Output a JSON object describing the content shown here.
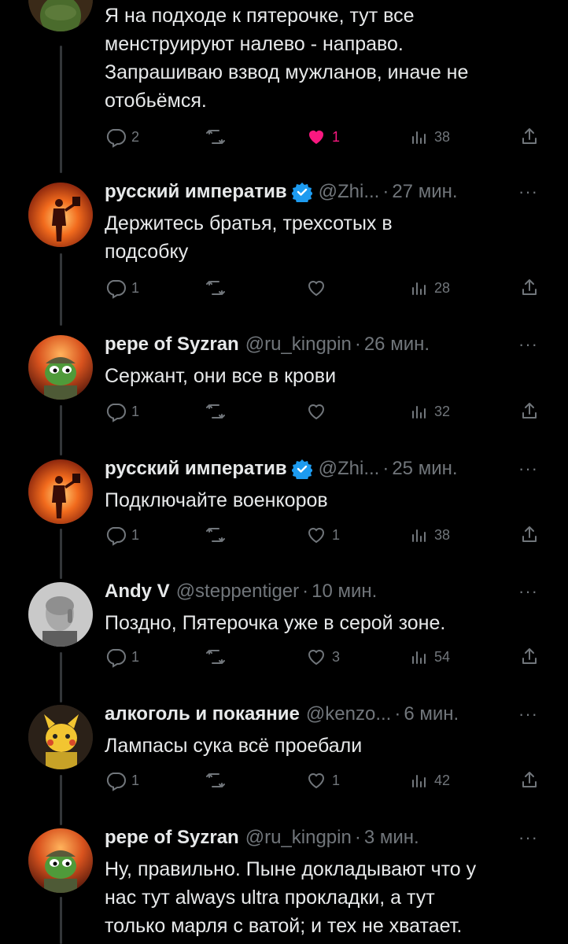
{
  "colors": {
    "background": "#000000",
    "text": "#e7e9ea",
    "muted": "#71767b",
    "like": "#f91880",
    "verified": "#1d9bf0",
    "thread_line": "#333639"
  },
  "icons": {
    "reply": "speech-bubble-icon",
    "retweet": "retweet-icon",
    "like": "heart-icon",
    "views": "bar-chart-icon",
    "share": "share-upload-icon",
    "more": "ellipsis-icon",
    "verified": "verified-badge-icon"
  },
  "more_label": "···",
  "tweets": [
    {
      "name": "",
      "handle": "",
      "time": "",
      "text_lines": [
        "Я на подходе к пятерочке, тут все",
        "менструируют налево - направо.",
        "Запрашиваю взвод мужланов, иначе не",
        "отобьёмся."
      ],
      "replies": "2",
      "retweets": "",
      "likes": "1",
      "liked": true,
      "views": "38"
    },
    {
      "name": "русский императив",
      "verified": true,
      "handle": "@Zhi...",
      "time": "27 мин.",
      "text_lines": [
        "Держитесь братья, трехсотых в",
        "подсобку"
      ],
      "replies": "1",
      "retweets": "",
      "likes": "",
      "liked": false,
      "views": "28"
    },
    {
      "name": "pepe of Syzran",
      "verified": false,
      "handle": "@ru_kingpin",
      "time": "26 мин.",
      "text_lines": [
        "Сержант, они все в крови"
      ],
      "replies": "1",
      "retweets": "",
      "likes": "",
      "liked": false,
      "views": "32"
    },
    {
      "name": "русский императив",
      "verified": true,
      "handle": "@Zhi...",
      "time": "25 мин.",
      "text_lines": [
        "Подключайте военкоров"
      ],
      "replies": "1",
      "retweets": "",
      "likes": "1",
      "liked": false,
      "views": "38"
    },
    {
      "name": "Andy V",
      "verified": false,
      "handle": "@steppentiger",
      "time": "10 мин.",
      "text_lines": [
        "Поздно, Пятерочка уже в серой зоне."
      ],
      "replies": "1",
      "retweets": "",
      "likes": "3",
      "liked": false,
      "views": "54"
    },
    {
      "name": "алкоголь и покаяние",
      "verified": false,
      "handle": "@kenzo...",
      "time": "6 мин.",
      "text_lines": [
        "Лампасы сука всё проебали"
      ],
      "replies": "1",
      "retweets": "",
      "likes": "1",
      "liked": false,
      "views": "42"
    },
    {
      "name": "pepe of Syzran",
      "verified": false,
      "handle": "@ru_kingpin",
      "time": "3 мин.",
      "text_lines": [
        "Ну, правильно. Пыне докладывают что у",
        "нас тут always ultra прокладки, а тут",
        "только марля с ватой; и тех не хватает."
      ],
      "replies": "",
      "retweets": "",
      "likes": "",
      "liked": false,
      "views": ""
    }
  ]
}
